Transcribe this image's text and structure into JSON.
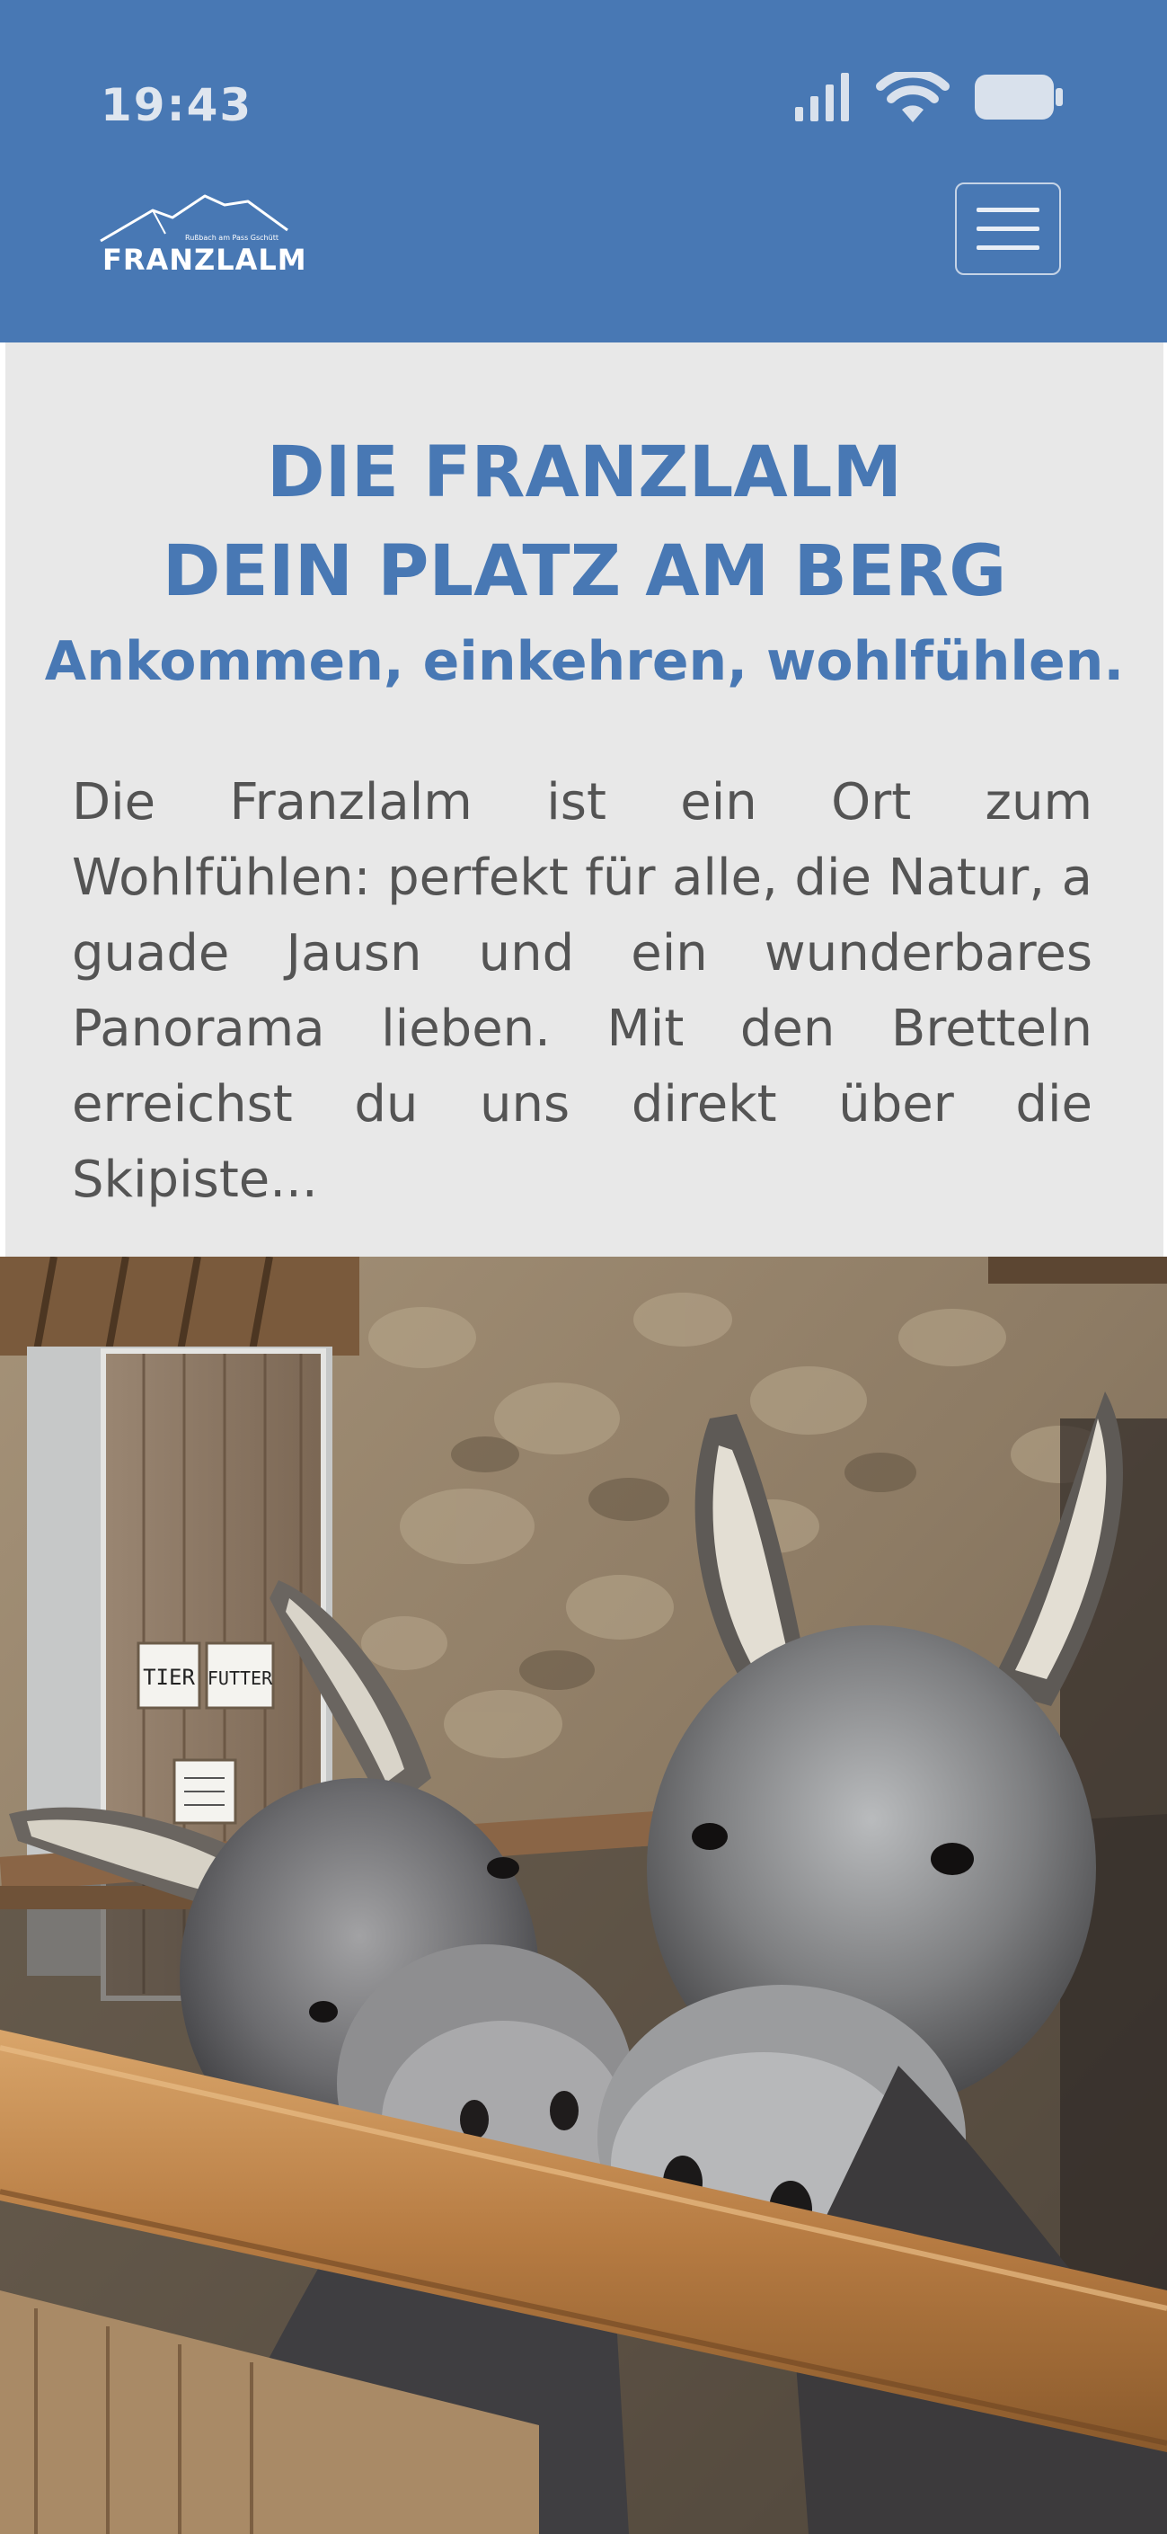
{
  "status_bar": {
    "time": "19:43",
    "icons": [
      "signal-icon",
      "wifi-icon",
      "battery-icon"
    ]
  },
  "header": {
    "logo_name": "FRANZLALM",
    "logo_tagline": "Rußbach am Pass Gschütt",
    "menu_icon": "hamburger-menu-icon"
  },
  "intro": {
    "title_line1": "DIE FRANZLALM",
    "title_line2": "DEIN PLATZ AM BERG",
    "subtitle": "Ankommen, einkehren, wohlfühlen.",
    "body": "Die Franzlalm ist ein Ort zum Wohlfühlen: perfekt für alle, die Natur, a guade Jausn und ein wunderbares Panorama lieben. Mit den Bretteln erreichst du uns direkt über die Skipiste..."
  },
  "photo": {
    "sign_left": "TIER",
    "sign_right": "FUTTER"
  },
  "colors": {
    "brand_blue": "#4878b4",
    "intro_background": "#e8e8e8",
    "body_text": "#545454"
  }
}
